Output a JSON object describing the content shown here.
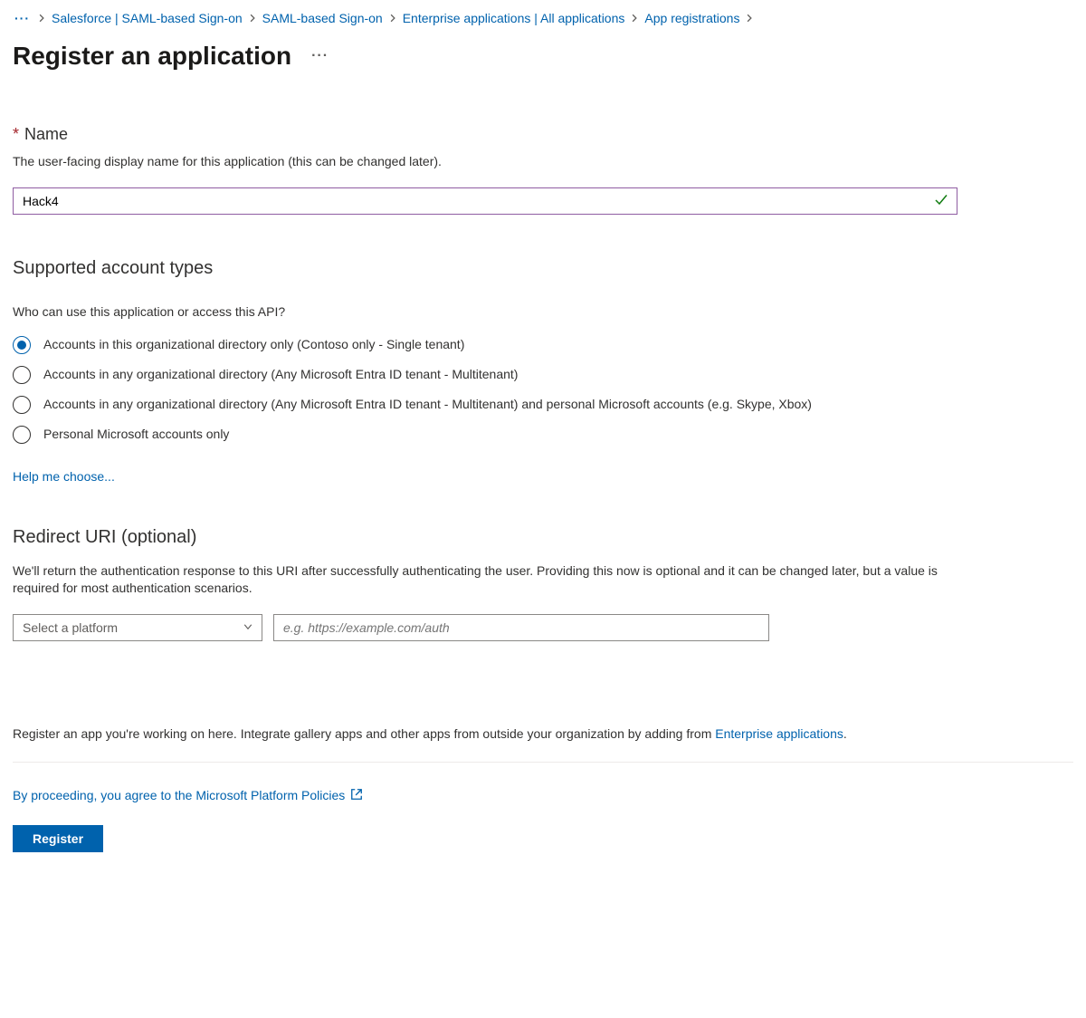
{
  "breadcrumb": {
    "more": "···",
    "items": [
      "Salesforce | SAML-based Sign-on",
      "SAML-based Sign-on",
      "Enterprise applications | All applications",
      "App registrations"
    ]
  },
  "header": {
    "title": "Register an application",
    "more": "···"
  },
  "name": {
    "label": "Name",
    "required": "*",
    "desc": "The user-facing display name for this application (this can be changed later).",
    "value": "Hack4"
  },
  "account": {
    "heading": "Supported account types",
    "question": "Who can use this application or access this API?",
    "options": [
      "Accounts in this organizational directory only (Contoso only - Single tenant)",
      "Accounts in any organizational directory (Any Microsoft Entra ID tenant - Multitenant)",
      "Accounts in any organizational directory (Any Microsoft Entra ID tenant - Multitenant) and personal Microsoft accounts (e.g. Skype, Xbox)",
      "Personal Microsoft accounts only"
    ],
    "selectedIndex": 0,
    "helpLink": "Help me choose..."
  },
  "redirect": {
    "heading": "Redirect URI (optional)",
    "desc": "We'll return the authentication response to this URI after successfully authenticating the user. Providing this now is optional and it can be changed later, but a value is required for most authentication scenarios.",
    "platformPlaceholder": "Select a platform",
    "uriPlaceholder": "e.g. https://example.com/auth"
  },
  "footer": {
    "text1": "Register an app you're working on here. Integrate gallery apps and other apps from outside your organization by adding from ",
    "link1": "Enterprise applications",
    "period": ".",
    "policy": "By proceeding, you agree to the Microsoft Platform Policies",
    "registerBtn": "Register"
  }
}
